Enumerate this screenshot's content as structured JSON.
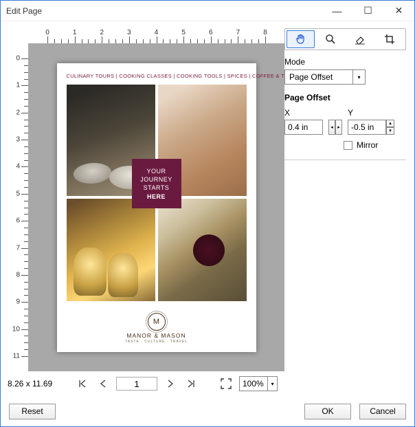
{
  "window": {
    "title": "Edit Page"
  },
  "tools": {
    "pan": "pan-icon",
    "zoom": "zoom-icon",
    "erase": "erase-icon",
    "crop": "crop-icon"
  },
  "mode": {
    "label": "Mode",
    "selected": "Page Offset"
  },
  "page_offset": {
    "section_label": "Page Offset",
    "x_label": "X",
    "y_label": "Y",
    "x_value": "0.4 in",
    "y_value": "-0.5 in",
    "mirror_label": "Mirror",
    "mirror_checked": false
  },
  "nav": {
    "dimensions": "8.26 x 11.69",
    "page": "1",
    "zoom": "100%"
  },
  "buttons": {
    "reset": "Reset",
    "ok": "OK",
    "cancel": "Cancel"
  },
  "ruler_h": [
    0,
    1,
    2,
    3,
    4,
    5,
    6,
    7,
    8
  ],
  "ruler_v": [
    0,
    1,
    2,
    3,
    4,
    5,
    6,
    7,
    8,
    9,
    10,
    11
  ],
  "page_preview": {
    "header": "CULINARY TOURS | COOKING CLASSES | COOKING TOOLS | SPICES | COFFEE & TEA",
    "center_l1": "YOUR",
    "center_l2": "JOURNEY",
    "center_l3": "STARTS",
    "center_l4": "HERE",
    "brand": "MANOR & MASON",
    "brand_sub": "TASTE · CULTURE · TRAVEL",
    "monogram": "M"
  }
}
